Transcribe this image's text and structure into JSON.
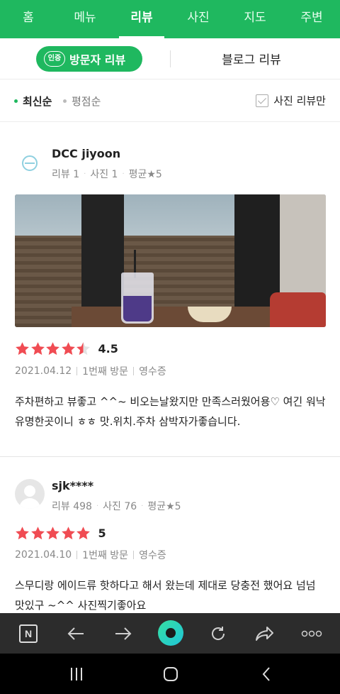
{
  "tabs": [
    {
      "label": "홈",
      "active": false
    },
    {
      "label": "메뉴",
      "active": false
    },
    {
      "label": "리뷰",
      "active": true
    },
    {
      "label": "사진",
      "active": false
    },
    {
      "label": "지도",
      "active": false
    },
    {
      "label": "주변",
      "active": false
    }
  ],
  "review_type": {
    "cert_badge": "인증",
    "visitor_label": "방문자 리뷰",
    "blog_label": "블로그 리뷰"
  },
  "sort": {
    "latest_label": "최신순",
    "rating_label": "평점순",
    "photo_only_label": "사진 리뷰만",
    "photo_only_checked": false
  },
  "reviews": [
    {
      "username": "DCC jiyoon",
      "review_count_label": "리뷰 1",
      "photo_count_label": "사진 1",
      "avg_label": "평균★5",
      "rating": 4.5,
      "rating_text": "4.5",
      "date": "2021.04.12",
      "visit": "1번째 방문",
      "receipt": "영수증",
      "text": "주차편하고 뷰좋고 ^^~ 비오는날왔지만 만족스러웠어용♡ 여긴 워낙 유명한곳이니 ㅎㅎ 맛.위치.주차 삼박자가좋습니다.",
      "has_photo": true
    },
    {
      "username": "sjk****",
      "review_count_label": "리뷰 498",
      "photo_count_label": "사진 76",
      "avg_label": "평균★5",
      "rating": 5,
      "rating_text": "5",
      "date": "2021.04.10",
      "visit": "1번째 방문",
      "receipt": "영수증",
      "text": "스무디랑 에이드류 핫하다고 해서 왔는데 제대로 당충전 했어요 넘넘 맛있구 ~^^ 사진찍기좋아요",
      "has_photo": false
    }
  ],
  "colors": {
    "brand_green": "#1fb85f",
    "star_red": "#f04c53",
    "toolbar_bg": "#2c2c2c"
  },
  "toolbar": {
    "icons": [
      "naver-n-icon",
      "back-arrow-icon",
      "forward-arrow-icon",
      "green-dot-icon",
      "refresh-icon",
      "share-icon",
      "more-icon"
    ],
    "n_letter": "N"
  }
}
